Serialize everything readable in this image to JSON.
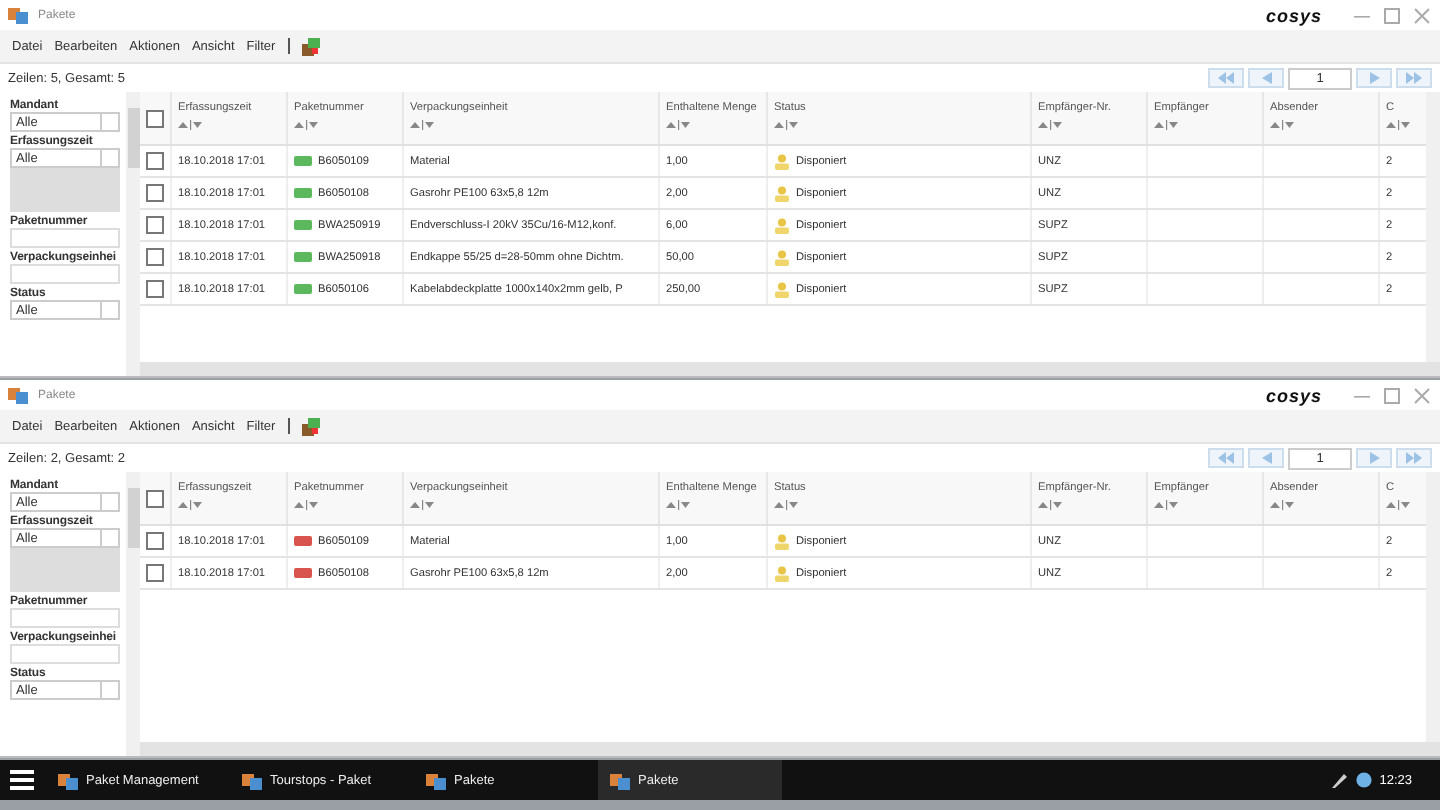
{
  "windows": [
    {
      "title": "Pakete",
      "logo": "cosys",
      "menu": [
        "Datei",
        "Bearbeiten",
        "Aktionen",
        "Ansicht",
        "Filter"
      ],
      "row_count": "Zeilen: 5, Gesamt: 5",
      "page": "1",
      "select_all_checked": false,
      "filters": [
        {
          "label": "Mandant",
          "kind": "select",
          "value": "Alle"
        },
        {
          "label": "Erfassungszeit",
          "kind": "date",
          "value": "Alle"
        },
        {
          "label": "Paketnummer",
          "kind": "text"
        },
        {
          "label": "Verpackungseinhei",
          "kind": "text"
        },
        {
          "label": "Status",
          "kind": "select",
          "value": "Alle"
        }
      ],
      "columns": [
        "Erfassungszeit",
        "Paketnummer",
        "Verpackungseinheit",
        "Enthaltene Menge",
        "Status",
        "Empfänger-Nr.",
        "Empfänger",
        "Absender",
        "C"
      ],
      "rows": [
        {
          "checked": false,
          "time": "18.10.2018 17:01",
          "number": "B6050109",
          "color": "#5cb85c",
          "unit": "Material",
          "qty": "1,00",
          "status": "Disponiert",
          "recipient_no": "UNZ",
          "column_10": "2"
        },
        {
          "checked": false,
          "time": "18.10.2018 17:01",
          "number": "B6050108",
          "color": "#5cb85c",
          "unit": "Gasrohr PE100 63x5,8 12m",
          "qty": "2,00",
          "status": "Disponiert",
          "recipient_no": "UNZ",
          "column_10": "2"
        },
        {
          "checked": false,
          "time": "18.10.2018 17:01",
          "number": "BWA250919",
          "color": "#5cb85c",
          "unit": "Endverschluss-I 20kV 35Cu/16-M12,konf.",
          "qty": "6,00",
          "status": "Disponiert",
          "recipient_no": "SUPZ",
          "column_10": "2"
        },
        {
          "checked": false,
          "time": "18.10.2018 17:01",
          "number": "BWA250918",
          "color": "#5cb85c",
          "unit": "Endkappe 55/25 d=28-50mm ohne Dichtm.",
          "qty": "50,00",
          "status": "Disponiert",
          "recipient_no": "SUPZ",
          "column_10": "2"
        },
        {
          "checked": false,
          "time": "18.10.2018 17:01",
          "number": "B6050106",
          "color": "#5cb85c",
          "unit": "Kabelabdeckplatte 1000x140x2mm gelb, P",
          "qty": "250,00",
          "status": "Disponiert",
          "recipient_no": "SUPZ",
          "column_10": "2"
        }
      ]
    },
    {
      "title": "Pakete",
      "logo": "cosys",
      "menu": [
        "Datei",
        "Bearbeiten",
        "Aktionen",
        "Ansicht",
        "Filter"
      ],
      "row_count": "Zeilen: 2, Gesamt: 2",
      "page": "1",
      "select_all_checked": false,
      "filters": [
        {
          "label": "Mandant",
          "kind": "select",
          "value": "Alle"
        },
        {
          "label": "Erfassungszeit",
          "kind": "date",
          "value": "Alle"
        },
        {
          "label": "Paketnummer",
          "kind": "text"
        },
        {
          "label": "Verpackungseinhei",
          "kind": "text"
        },
        {
          "label": "Status",
          "kind": "select",
          "value": "Alle"
        }
      ],
      "columns": [
        "Erfassungszeit",
        "Paketnummer",
        "Verpackungseinheit",
        "Enthaltene Menge",
        "Status",
        "Empfänger-Nr.",
        "Empfänger",
        "Absender",
        "C"
      ],
      "rows": [
        {
          "checked": false,
          "time": "18.10.2018 17:01",
          "number": "B6050109",
          "color": "#d9534f",
          "unit": "Material",
          "qty": "1,00",
          "status": "Disponiert",
          "recipient_no": "UNZ",
          "column_10": "2"
        },
        {
          "checked": false,
          "time": "18.10.2018 17:01",
          "number": "B6050108",
          "color": "#d9534f",
          "unit": "Gasrohr PE100 63x5,8 12m",
          "qty": "2,00",
          "status": "Disponiert",
          "recipient_no": "UNZ",
          "column_10": "2"
        }
      ]
    }
  ],
  "taskbar": {
    "items": [
      {
        "label": "Paket Management",
        "selected": false
      },
      {
        "label": "Tourstops - Paket",
        "selected": false
      },
      {
        "label": "Pakete",
        "selected": false
      },
      {
        "label": "Pakete",
        "selected": true
      }
    ],
    "clock": "12:23"
  }
}
